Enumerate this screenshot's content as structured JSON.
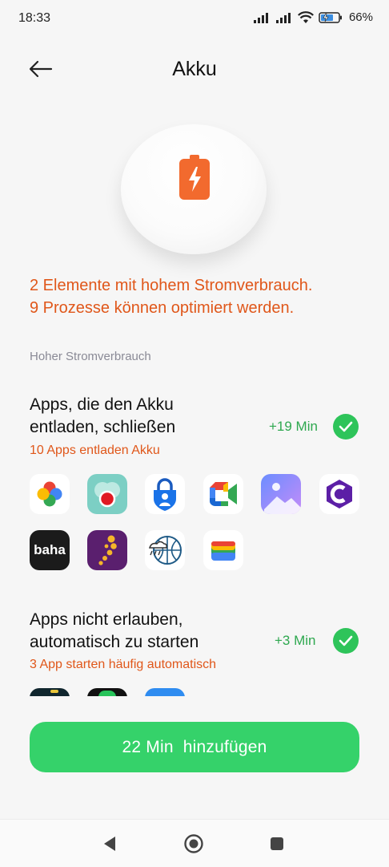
{
  "status": {
    "time": "18:33",
    "battery": "66%"
  },
  "header": {
    "title": "Akku"
  },
  "summary": {
    "line1": "2 Elemente mit hohem Stromverbrauch.",
    "line2": "9 Prozesse können optimiert werden."
  },
  "section_label": "Hoher Stromverbrauch",
  "rows": [
    {
      "title_line1": "Apps, die den Akku",
      "title_line2": "entladen, schließen",
      "subtitle": "10 Apps entladen Akku",
      "gain": "+19 Min"
    },
    {
      "title_line1": "Apps nicht erlauben,",
      "title_line2": "automatisch zu starten",
      "subtitle": "3 App starten häufig automatisch",
      "gain": "+3 Min"
    }
  ],
  "apps_row1": [
    {
      "icon": "google-photos-icon"
    },
    {
      "icon": "tracker-app-icon"
    },
    {
      "icon": "microsoft-authenticator-icon"
    },
    {
      "icon": "google-meet-icon"
    },
    {
      "icon": "gallery-icon"
    },
    {
      "icon": "c-launcher-icon"
    }
  ],
  "apps_row2": [
    {
      "icon": "baha-icon",
      "label": "baha"
    },
    {
      "icon": "dots-app-icon"
    },
    {
      "icon": "weather-radar-icon"
    },
    {
      "icon": "google-wallet-icon"
    }
  ],
  "cta": {
    "label": "22 Min  hinzufügen"
  },
  "colors": {
    "accent_green": "#35d26a",
    "warning_orange": "#e0571a",
    "battery_orange": "#f26a2e"
  }
}
